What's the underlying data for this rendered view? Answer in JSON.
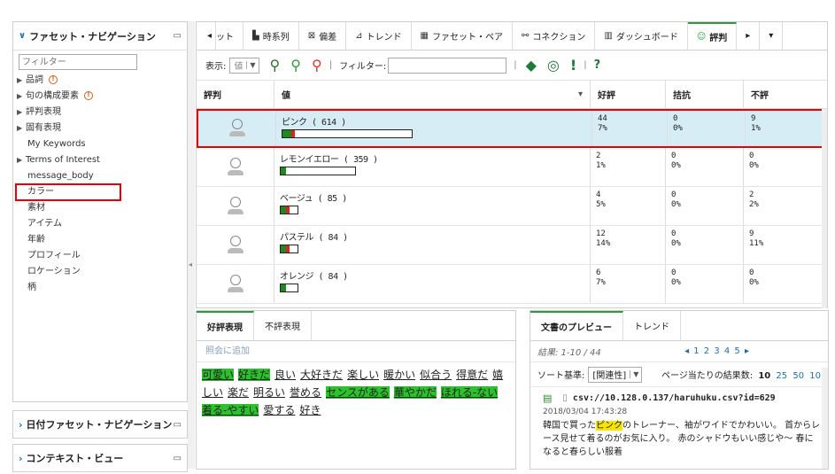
{
  "sidebar": {
    "title": "ファセット・ナビゲーション",
    "filter_placeholder": "フィルター",
    "items": [
      {
        "label": "品詞",
        "expandable": true,
        "warning": true
      },
      {
        "label": "句の構成要素",
        "expandable": true,
        "warning": true
      },
      {
        "label": "評判表現",
        "expandable": true,
        "warning": false
      },
      {
        "label": "固有表現",
        "expandable": true,
        "warning": false
      },
      {
        "label": "My Keywords",
        "expandable": false,
        "warning": false
      },
      {
        "label": "Terms of Interest",
        "expandable": true,
        "warning": false
      },
      {
        "label": "message_body",
        "expandable": false,
        "warning": false
      },
      {
        "label": "カラー",
        "expandable": false,
        "warning": false,
        "selected": true
      },
      {
        "label": "素材",
        "expandable": false,
        "warning": false
      },
      {
        "label": "アイテム",
        "expandable": false,
        "warning": false
      },
      {
        "label": "年齢",
        "expandable": false,
        "warning": false
      },
      {
        "label": "プロフィール",
        "expandable": false,
        "warning": false
      },
      {
        "label": "ロケーション",
        "expandable": false,
        "warning": false
      },
      {
        "label": "柄",
        "expandable": false,
        "warning": false
      }
    ],
    "date_facet": "日付ファセット・ナビゲーション",
    "context_view": "コンテキスト・ビュー"
  },
  "tabs": [
    {
      "label": "ット",
      "icon": "prev-arrow-icon"
    },
    {
      "label": "時系列",
      "icon": "timeseries-icon"
    },
    {
      "label": "偏差",
      "icon": "deviation-icon"
    },
    {
      "label": "トレンド",
      "icon": "trend-icon"
    },
    {
      "label": "ファセット・ペア",
      "icon": "facet-pair-icon"
    },
    {
      "label": "コネクション",
      "icon": "connection-icon"
    },
    {
      "label": "ダッシュボード",
      "icon": "dashboard-icon"
    },
    {
      "label": "評判",
      "icon": "reputation-icon",
      "active": true
    }
  ],
  "toolbar": {
    "display_label": "表示:",
    "display_value": "値",
    "filter_label": "フィルター:",
    "filter_value": ""
  },
  "table": {
    "headers": [
      "評判",
      "値",
      "好評",
      "拮抗",
      "不評"
    ],
    "rows": [
      {
        "value": "ピンク ( 614 )",
        "pos": "44",
        "pos_pct": "7%",
        "neu": "0",
        "neu_pct": "0%",
        "neg": "9",
        "neg_pct": "1%",
        "bar_width": 1.0,
        "green": 0.07,
        "red": 0.01,
        "selected": true
      },
      {
        "value": "レモンイエロー ( 359 )",
        "pos": "2",
        "pos_pct": "1%",
        "neu": "0",
        "neu_pct": "0%",
        "neg": "0",
        "neg_pct": "0%",
        "bar_width": 0.58,
        "green": 0.01,
        "red": 0.0
      },
      {
        "value": "ベージュ ( 85 )",
        "pos": "4",
        "pos_pct": "5%",
        "neu": "0",
        "neu_pct": "0%",
        "neg": "2",
        "neg_pct": "2%",
        "bar_width": 0.14,
        "green": 0.05,
        "red": 0.02
      },
      {
        "value": "パステル ( 84 )",
        "pos": "12",
        "pos_pct": "14%",
        "neu": "0",
        "neu_pct": "0%",
        "neg": "9",
        "neg_pct": "11%",
        "bar_width": 0.14,
        "green": 0.14,
        "red": 0.11
      },
      {
        "value": "オレンジ ( 84 )",
        "pos": "6",
        "pos_pct": "7%",
        "neu": "0",
        "neu_pct": "0%",
        "neg": "0",
        "neg_pct": "0%",
        "bar_width": 0.14,
        "green": 0.07,
        "red": 0.0
      }
    ]
  },
  "expr_panel": {
    "tab_positive": "好評表現",
    "tab_negative": "不評表現",
    "add_ref": "照会に追加",
    "words": [
      {
        "text": "可愛い",
        "hl": true
      },
      {
        "text": "好きだ",
        "hl": true
      },
      {
        "text": "良い",
        "hl": false
      },
      {
        "text": "大好きだ",
        "hl": false
      },
      {
        "text": "楽しい",
        "hl": false
      },
      {
        "text": "暖かい",
        "hl": false
      },
      {
        "text": "似合う",
        "hl": false
      },
      {
        "text": "得意だ",
        "hl": false
      },
      {
        "text": "嬉しい",
        "hl": false
      },
      {
        "text": "楽だ",
        "hl": false
      },
      {
        "text": "明るい",
        "hl": false
      },
      {
        "text": "誉める",
        "hl": false
      },
      {
        "text": "センスがある",
        "hl": true
      },
      {
        "text": "華やかだ",
        "hl": true
      },
      {
        "text": "ほれる-ない",
        "hl": true
      },
      {
        "text": "着る-やすい",
        "hl": true
      },
      {
        "text": "愛する",
        "hl": false
      },
      {
        "text": "好き",
        "hl": false
      }
    ]
  },
  "doc_panel": {
    "tab_preview": "文書のプレビュー",
    "tab_trend": "トレンド",
    "results": "結果: 1-10 / 44",
    "pager": "◂ 1 2 3 4 5 ▸",
    "sort_label": "ソート基準:",
    "sort_value": "[関連性]",
    "per_page_label": "ページ当たりの結果数:",
    "per_page_current": "10",
    "per_page_opts": [
      "25",
      "50",
      "10"
    ],
    "doc_url": "csv://10.128.0.137/haruhuku.csv?id=629",
    "doc_date": "2018/03/04 17:43:28",
    "doc_text_pre": "韓国で買った",
    "doc_text_hl": "ピンク",
    "doc_text_post": "のトレーナー、袖がワイドでかわいい。 首からレース見せて着るのがお気に入り。 赤のシャドウもいい感じや〜 春になると春らしい服着"
  }
}
